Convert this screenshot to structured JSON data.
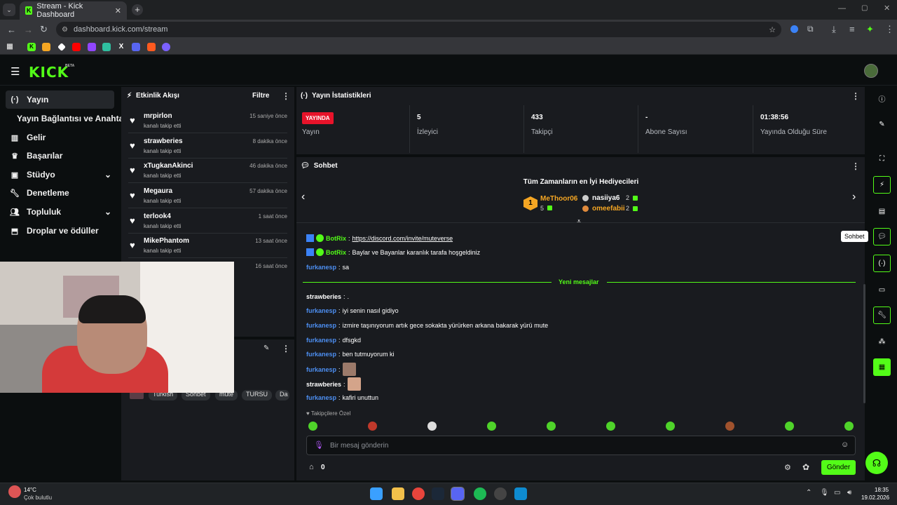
{
  "browser": {
    "tab_title": "Stream - Kick Dashboard",
    "url": "dashboard.kick.com/stream"
  },
  "app": {
    "logo": "KICK",
    "beta": "BETA"
  },
  "nav": {
    "items": [
      {
        "label": "Yayın",
        "icon": "broadcast-icon"
      },
      {
        "label": "Yayın Bağlantısı ve Anahtarı",
        "icon": ""
      },
      {
        "label": "Gelir",
        "icon": "revenue-icon"
      },
      {
        "label": "Başarılar",
        "icon": "trophy-icon"
      },
      {
        "label": "Stüdyo",
        "icon": "studio-icon"
      },
      {
        "label": "Denetleme",
        "icon": "wrench-icon"
      },
      {
        "label": "Topluluk",
        "icon": "community-icon"
      },
      {
        "label": "Droplar ve ödüller",
        "icon": "gift-icon"
      }
    ]
  },
  "activity": {
    "title": "Etkinlik Akışı",
    "filter": "Filtre",
    "items": [
      {
        "name": "mrpirlon",
        "action": "kanalı takip etti",
        "time": "15 saniye önce"
      },
      {
        "name": "strawberies",
        "action": "kanalı takip etti",
        "time": "8 dakika önce"
      },
      {
        "name": "xTugkanAkinci",
        "action": "kanalı takip etti",
        "time": "46 dakika önce"
      },
      {
        "name": "Megaura",
        "action": "kanalı takip etti",
        "time": "57 dakika önce"
      },
      {
        "name": "terlook4",
        "action": "kanalı takip etti",
        "time": "1 saat önce"
      },
      {
        "name": "MikePhantom",
        "action": "kanalı takip etti",
        "time": "13 saat önce"
      },
      {
        "name": "",
        "action": "",
        "time": "16 saat önce"
      }
    ]
  },
  "stream_info": {
    "tags": [
      "Turkish",
      "Sohbet",
      "mute",
      "TURSU",
      "Da"
    ]
  },
  "stats": {
    "title": "Yayın İstatistikleri",
    "live_badge": "YAYINDA",
    "items": [
      {
        "value": "",
        "label": "Yayın"
      },
      {
        "value": "5",
        "label": "İzleyici"
      },
      {
        "value": "433",
        "label": "Takipçi"
      },
      {
        "value": "-",
        "label": "Abone Sayısı"
      },
      {
        "value": "01:38:56",
        "label": "Yayında Olduğu Süre"
      }
    ]
  },
  "chat": {
    "title": "Sohbet",
    "gifters_title": "Tüm Zamanların en İyi Hediyecileri",
    "top_gifter": {
      "rank": "1",
      "name": "MeThoor06",
      "amount": "5"
    },
    "gifters": [
      {
        "name": "nasiiya6",
        "amount": "2"
      },
      {
        "name": "omeefabii",
        "amount": "2"
      }
    ],
    "new_messages": "Yeni mesajlar",
    "messages": [
      {
        "user": "BotRix",
        "text": "https://discord.com/invite/muteverse",
        "color": "#53fc18",
        "link": true
      },
      {
        "user": "BotRix",
        "text": "Baylar ve Bayanlar karanlık tarafa hoşgeldiniz",
        "color": "#53fc18"
      },
      {
        "user": "furkanesp",
        "text": "sa",
        "color": "#4d8ff2"
      },
      {
        "user": "strawberies",
        "text": ".",
        "color": "#ffffff"
      },
      {
        "user": "furkanesp",
        "text": "iyi senin nasıl gidiyo",
        "color": "#4d8ff2"
      },
      {
        "user": "furkanesp",
        "text": "izmire taşınıyorum artık gece sokakta yürürken arkana bakarak yürü mute",
        "color": "#4d8ff2"
      },
      {
        "user": "furkanesp",
        "text": "dfsgkd",
        "color": "#4d8ff2"
      },
      {
        "user": "furkanesp",
        "text": "ben tutmuyorum ki",
        "color": "#4d8ff2"
      },
      {
        "user": "furkanesp",
        "text": "",
        "color": "#4d8ff2"
      },
      {
        "user": "strawberies",
        "text": "",
        "color": "#ffffff"
      },
      {
        "user": "furkanesp",
        "text": "kafiri unuttun",
        "color": "#4d8ff2"
      }
    ],
    "followers_only": "Takipçilere Özel",
    "input_placeholder": "Bir mesaj gönderin",
    "points": "0",
    "send": "Gönder"
  },
  "sidebar_tooltip": "Sohbet",
  "taskbar": {
    "weather_temp": "14°C",
    "weather_desc": "Çok bulutlu",
    "time": "18:35",
    "date": "19.02.2026"
  }
}
